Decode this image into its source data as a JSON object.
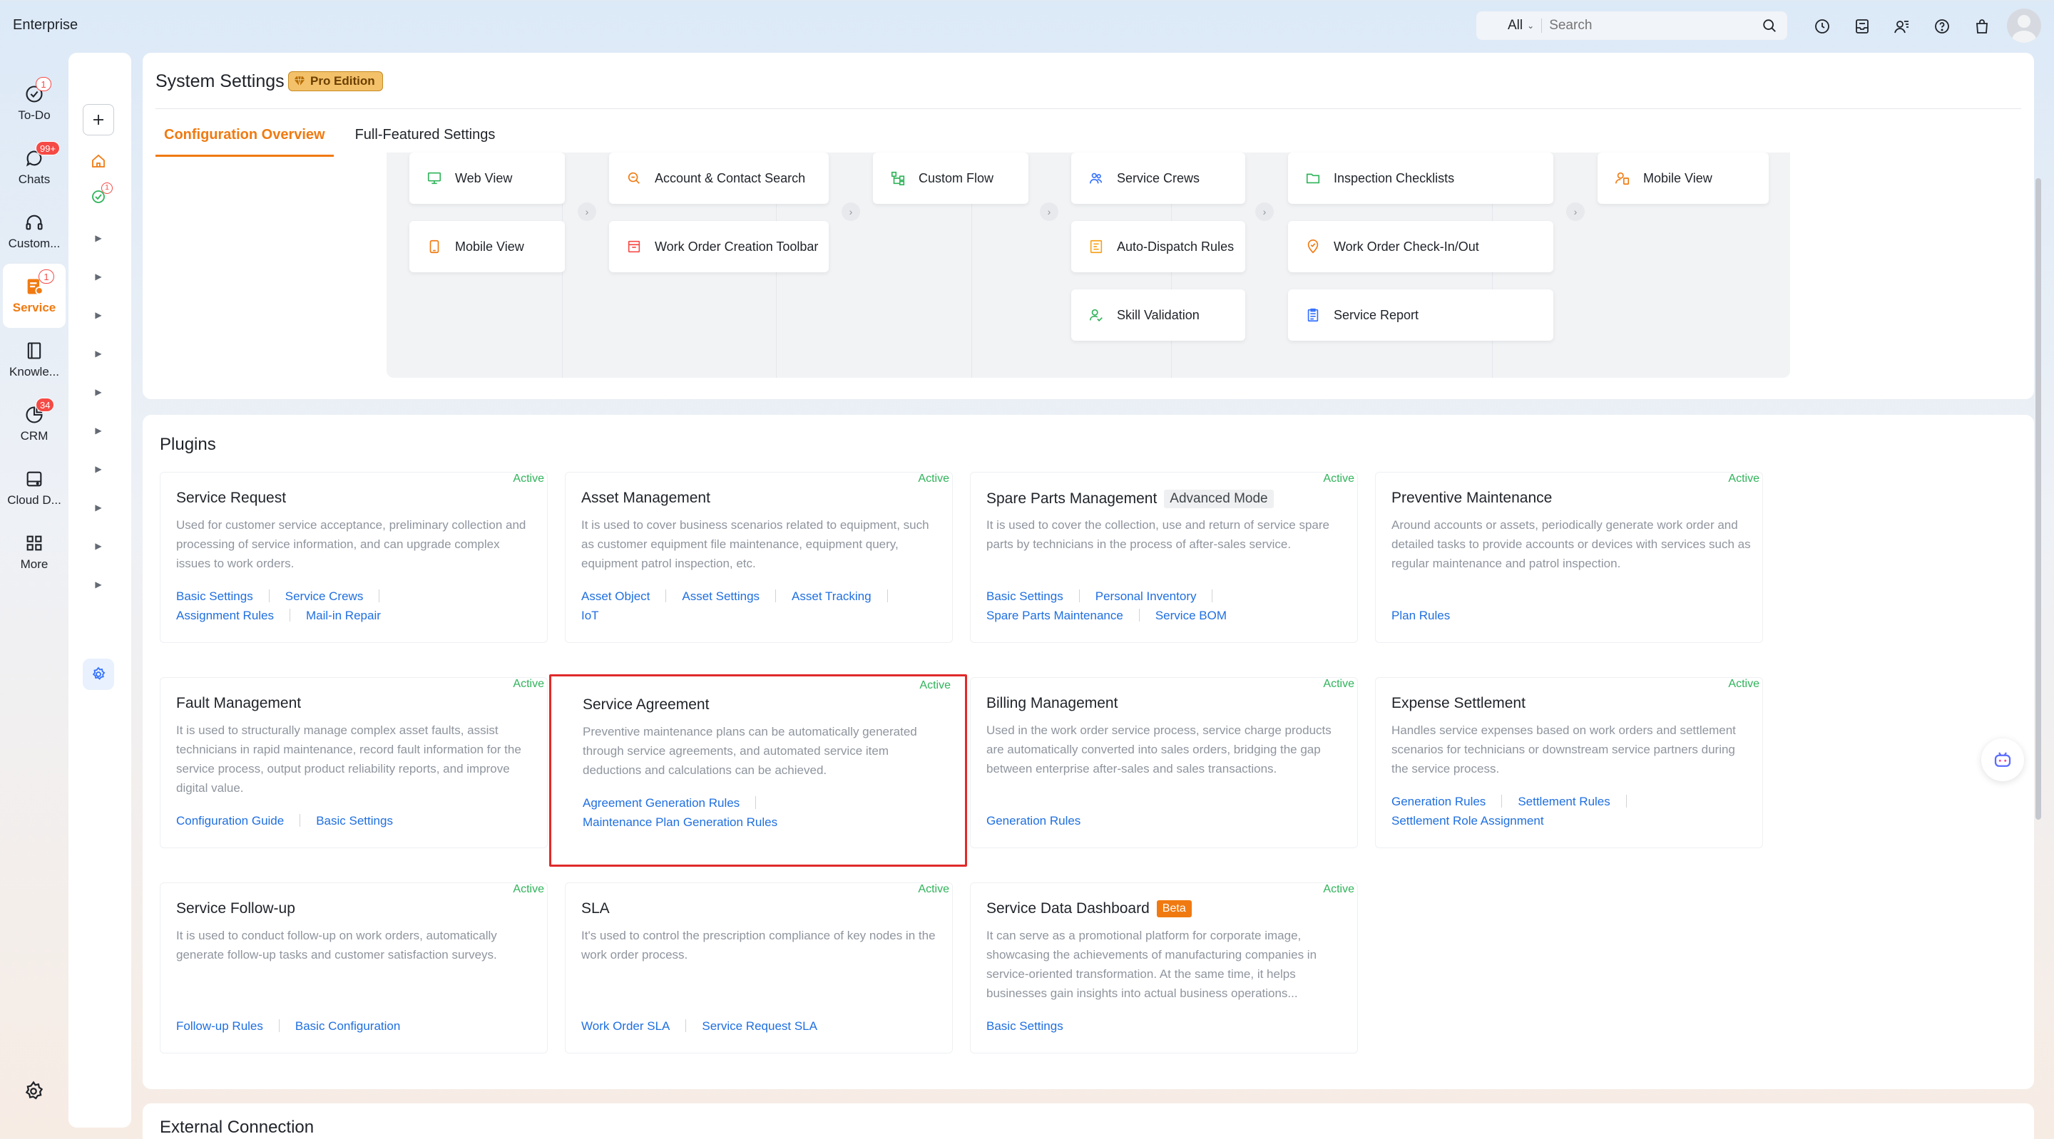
{
  "app": {
    "brand": "Enterprise"
  },
  "search": {
    "scope": "All",
    "placeholder": "Search"
  },
  "rail": [
    {
      "id": "todo",
      "label": "To-Do",
      "badge": "1",
      "badge_style": "outline"
    },
    {
      "id": "chats",
      "label": "Chats",
      "badge": "99+",
      "badge_style": "solid"
    },
    {
      "id": "customer",
      "label": "Custom...",
      "badge": ""
    },
    {
      "id": "service",
      "label": "Service",
      "badge": "1",
      "badge_style": "outline",
      "active": true
    },
    {
      "id": "knowledge",
      "label": "Knowle...",
      "badge": ""
    },
    {
      "id": "crm",
      "label": "CRM",
      "badge": "34",
      "badge_style": "solid"
    },
    {
      "id": "cloud",
      "label": "Cloud D...",
      "badge": ""
    },
    {
      "id": "more",
      "label": "More",
      "badge": ""
    }
  ],
  "subnav": {
    "todo_badge": "1"
  },
  "page": {
    "title": "System Settings",
    "edition": "Pro Edition",
    "tabs": [
      {
        "label": "Configuration Overview",
        "active": true
      },
      {
        "label": "Full-Featured Settings",
        "active": false
      }
    ]
  },
  "flow": {
    "col1": [
      "Web View",
      "Mobile View"
    ],
    "col2": [
      "Account & Contact Search",
      "Work Order Creation Toolbar"
    ],
    "col3": [
      "Custom Flow"
    ],
    "col4": [
      "Service Crews",
      "Auto-Dispatch Rules",
      "Skill Validation"
    ],
    "col5": [
      "Inspection Checklists",
      "Work Order Check-In/Out",
      "Service Report"
    ],
    "col6": [
      "Mobile View"
    ]
  },
  "plugins": {
    "title": "Plugins",
    "cards": [
      {
        "title": "Service Request",
        "status": "Active",
        "desc": "Used for customer service acceptance, preliminary collection and processing of service information, and can upgrade complex issues to work orders.",
        "links": [
          [
            "Basic Settings",
            "Service Crews"
          ],
          [
            "Assignment Rules",
            "Mail-in Repair"
          ]
        ]
      },
      {
        "title": "Asset Management",
        "status": "Active",
        "desc": "It is used to cover business scenarios related to equipment, such as customer equipment file maintenance, equipment query, equipment patrol inspection, etc.",
        "links": [
          [
            "Asset Object",
            "Asset Settings",
            "Asset Tracking"
          ],
          [
            "IoT"
          ]
        ]
      },
      {
        "title": "Spare Parts Management",
        "tag": "Advanced Mode",
        "status": "Active",
        "desc": "It is used to cover the collection, use and return of service spare parts by technicians in the process of after-sales service.",
        "links": [
          [
            "Basic Settings",
            "Personal Inventory"
          ],
          [
            "Spare Parts Maintenance",
            "Service BOM"
          ]
        ]
      },
      {
        "title": "Preventive Maintenance",
        "status": "Active",
        "desc": "Around accounts or assets, periodically generate work order and detailed tasks to provide accounts or devices with services such as regular maintenance and patrol inspection.",
        "links": [
          [
            "Plan Rules"
          ]
        ]
      },
      {
        "title": "Fault Management",
        "status": "Active",
        "desc": "It is used to structurally manage complex asset faults, assist technicians in rapid maintenance, record fault information for the service process, output product reliability reports, and improve digital value.",
        "links": [
          [
            "Configuration Guide",
            "Basic Settings"
          ]
        ]
      },
      {
        "title": "Service Agreement",
        "status": "Active",
        "desc": "Preventive maintenance plans can be automatically generated through service agreements, and automated service item deductions and calculations can be achieved.",
        "links": [
          [
            "Agreement Generation Rules"
          ],
          [
            "Maintenance Plan Generation Rules"
          ]
        ]
      },
      {
        "title": "Billing Management",
        "status": "Active",
        "desc": "Used in the work order service process, service charge products are automatically converted into sales orders, bridging the gap between enterprise after-sales and sales transactions.",
        "links": [
          [
            "Generation Rules"
          ]
        ]
      },
      {
        "title": "Expense Settlement",
        "status": "Active",
        "desc": "Handles service expenses based on work orders and settlement scenarios for technicians or downstream service partners during the service process.",
        "links": [
          [
            "Generation Rules",
            "Settlement Rules"
          ],
          [
            "Settlement Role Assignment"
          ]
        ]
      },
      {
        "title": "Service Follow-up",
        "status": "Active",
        "desc": "It is used to conduct follow-up on work orders, automatically generate follow-up tasks and customer satisfaction surveys.",
        "links": [
          [
            "Follow-up Rules",
            "Basic Configuration"
          ]
        ]
      },
      {
        "title": "SLA",
        "status": "Active",
        "desc": "It's used to control the prescription compliance of key nodes in the work order process.",
        "links": [
          [
            "Work Order SLA",
            "Service Request SLA"
          ]
        ]
      },
      {
        "title": "Service Data Dashboard",
        "tag_beta": "Beta",
        "status": "Active",
        "desc": "It can serve as a promotional platform for corporate image, showcasing the achievements of manufacturing companies in service-oriented transformation. At the same time, it helps businesses gain insights into actual business operations...",
        "links": [
          [
            "Basic Settings"
          ]
        ]
      }
    ]
  },
  "next_section": {
    "title": "External Connection"
  },
  "colors": {
    "accent": "#f07a11",
    "link": "#1f6fe0",
    "active_status": "#2fb35a",
    "highlight": "#e02a2a"
  }
}
